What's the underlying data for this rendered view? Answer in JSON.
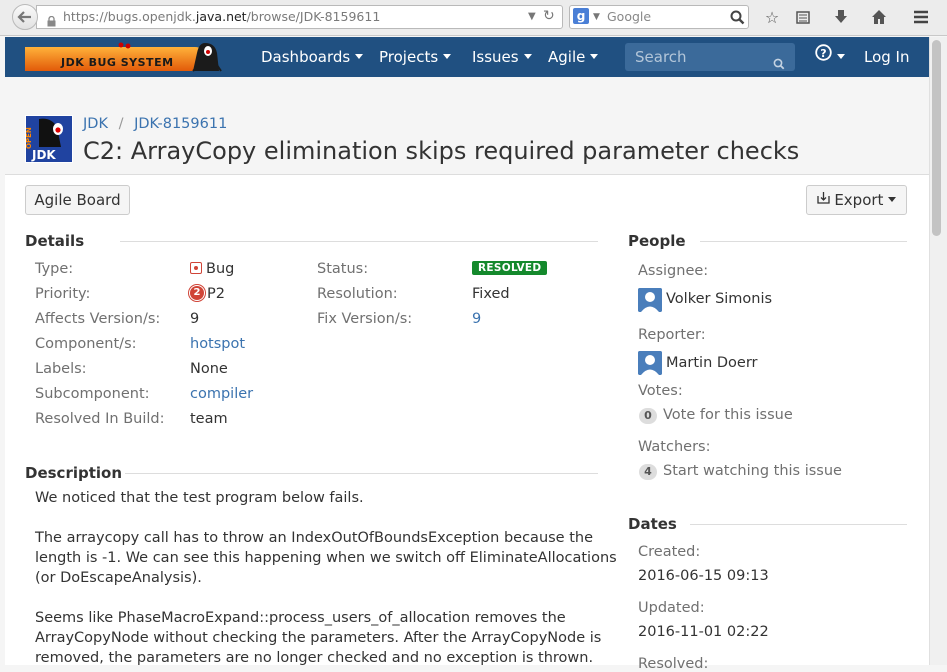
{
  "browser": {
    "url_prefix": "https://bugs.openjdk.",
    "url_host": "java.net",
    "url_path": "/browse/JDK-8159611",
    "search_placeholder": "Google"
  },
  "nav": {
    "logo_text": "JDK BUG SYSTEM",
    "items": [
      "Dashboards",
      "Projects",
      "Issues",
      "Agile"
    ],
    "search_placeholder": "Search",
    "help_icon": "question-circle-icon",
    "login": "Log In"
  },
  "issue": {
    "project": "JDK",
    "key": "JDK-8159611",
    "title": "C2: ArrayCopy elimination skips required parameter checks",
    "project_avatar_text_top": "OPEN",
    "project_avatar_text_bottom": "JDK"
  },
  "toolbar": {
    "agile_board": "Agile Board",
    "export": "Export"
  },
  "details": {
    "heading": "Details",
    "left": [
      {
        "label": "Type:",
        "value": "Bug"
      },
      {
        "label": "Priority:",
        "value": "P2"
      },
      {
        "label": "Affects Version/s:",
        "value": "9"
      },
      {
        "label": "Component/s:",
        "value": "hotspot"
      },
      {
        "label": "Labels:",
        "value": "None"
      },
      {
        "label": "Subcomponent:",
        "value": "compiler"
      },
      {
        "label": "Resolved In Build:",
        "value": "team"
      }
    ],
    "right": [
      {
        "label": "Status:",
        "value": "RESOLVED"
      },
      {
        "label": "Resolution:",
        "value": "Fixed"
      },
      {
        "label": "Fix Version/s:",
        "value": "9"
      }
    ],
    "priority_badge": "2",
    "status_color": "#14892c"
  },
  "description": {
    "heading": "Description",
    "paragraphs": [
      [
        "We noticed that the test program below fails."
      ],
      [
        "The arraycopy call has to throw an IndexOutOfBoundsException because the",
        "length is -1. We can see this happening when we switch off EliminateAllocations",
        "(or DoEscapeAnalysis)."
      ],
      [
        "Seems like PhaseMacroExpand::process_users_of_allocation removes the",
        "ArrayCopyNode without checking the parameters. After the ArrayCopyNode is",
        "removed, the parameters are no longer checked and no exception is thrown."
      ]
    ]
  },
  "people": {
    "heading": "People",
    "assignee_label": "Assignee:",
    "assignee": "Volker Simonis",
    "reporter_label": "Reporter:",
    "reporter": "Martin Doerr",
    "votes_label": "Votes:",
    "votes_count": "0",
    "vote_link": "Vote for this issue",
    "watchers_label": "Watchers:",
    "watchers_count": "4",
    "watch_link": "Start watching this issue"
  },
  "dates": {
    "heading": "Dates",
    "created_label": "Created:",
    "created": "2016-06-15 09:13",
    "updated_label": "Updated:",
    "updated": "2016-11-01 02:22",
    "resolved_label": "Resolved:"
  }
}
